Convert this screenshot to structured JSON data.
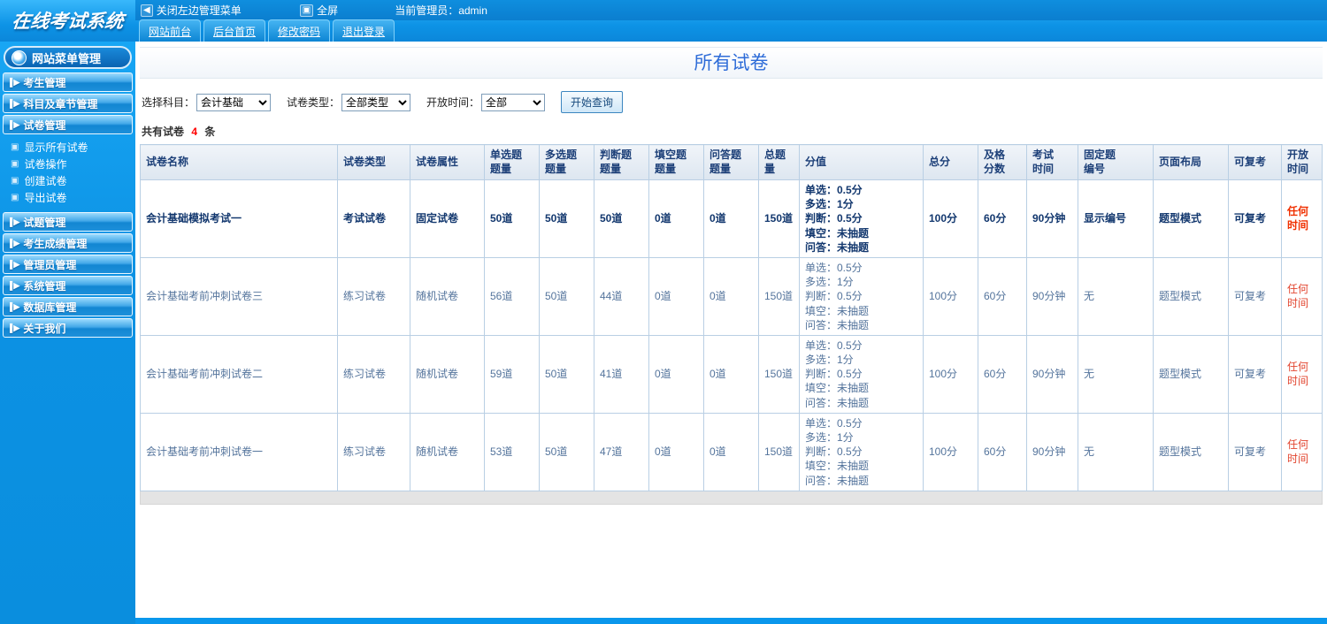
{
  "topbar": {
    "logo": "在线考试系统",
    "close_menu_label": "关闭左边管理菜单",
    "close_icon": "◀",
    "fullscreen_label": "全屏",
    "fullscreen_icon": "▣",
    "admin_label": "当前管理员：admin",
    "tabs": [
      "网站前台",
      "后台首页",
      "修改密码",
      "退出登录"
    ]
  },
  "sidebar": {
    "title": "网站菜单管理",
    "arrow_icon": "▌▶",
    "grid_icon": "▣",
    "items": [
      {
        "label": "考生管理"
      },
      {
        "label": "科目及章节管理"
      },
      {
        "label": "试卷管理",
        "children": [
          "显示所有试卷",
          "试卷操作",
          "创建试卷",
          "导出试卷"
        ]
      },
      {
        "label": "试题管理"
      },
      {
        "label": "考生成绩管理"
      },
      {
        "label": "管理员管理"
      },
      {
        "label": "系统管理"
      },
      {
        "label": "数据库管理"
      },
      {
        "label": "关于我们"
      }
    ]
  },
  "main": {
    "title": "所有试卷",
    "filters": {
      "subject_label": "选择科目：",
      "subject_value": "会计基础",
      "type_label": "试卷类型：",
      "type_value": "全部类型",
      "time_label": "开放时间：",
      "time_value": "全部",
      "search_button": "开始查询"
    },
    "summary": {
      "prefix": "共有试卷",
      "count": "4",
      "suffix": "条"
    },
    "table": {
      "headers": [
        "试卷名称",
        "试卷类型",
        "试卷属性",
        "单选题\n题量",
        "多选题\n题量",
        "判断题\n题量",
        "填空题\n题量",
        "问答题\n题量",
        "总题量",
        "分值",
        "总分",
        "及格\n分数",
        "考试\n时间",
        "固定题\n编号",
        "页面布局",
        "可复考",
        "开放时间"
      ],
      "rows": [
        [
          "会计基础模拟考试一",
          "考试试卷",
          "固定试卷",
          "50道",
          "50道",
          "50道",
          "0道",
          "0道",
          "150道",
          "单选：0.5分\n多选：1分\n判断：0.5分\n填空：未抽题\n问答：未抽题",
          "100分",
          "60分",
          "90分钟",
          "显示编号",
          "题型模式",
          "可复考",
          "任何时间"
        ],
        [
          "会计基础考前冲刺试卷三",
          "练习试卷",
          "随机试卷",
          "56道",
          "50道",
          "44道",
          "0道",
          "0道",
          "150道",
          "单选：0.5分\n多选：1分\n判断：0.5分\n填空：未抽题\n问答：未抽题",
          "100分",
          "60分",
          "90分钟",
          "无",
          "题型模式",
          "可复考",
          "任何时间"
        ],
        [
          "会计基础考前冲刺试卷二",
          "练习试卷",
          "随机试卷",
          "59道",
          "50道",
          "41道",
          "0道",
          "0道",
          "150道",
          "单选：0.5分\n多选：1分\n判断：0.5分\n填空：未抽题\n问答：未抽题",
          "100分",
          "60分",
          "90分钟",
          "无",
          "题型模式",
          "可复考",
          "任何时间"
        ],
        [
          "会计基础考前冲刺试卷一",
          "练习试卷",
          "随机试卷",
          "53道",
          "50道",
          "47道",
          "0道",
          "0道",
          "150道",
          "单选：0.5分\n多选：1分\n判断：0.5分\n填空：未抽题\n问答：未抽题",
          "100分",
          "60分",
          "90分钟",
          "无",
          "题型模式",
          "可复考",
          "任何时间"
        ]
      ]
    }
  },
  "colors": {
    "accent_blue": "#1286d2",
    "title_blue": "#2e6cd8",
    "alert_red": "#e2452f"
  }
}
